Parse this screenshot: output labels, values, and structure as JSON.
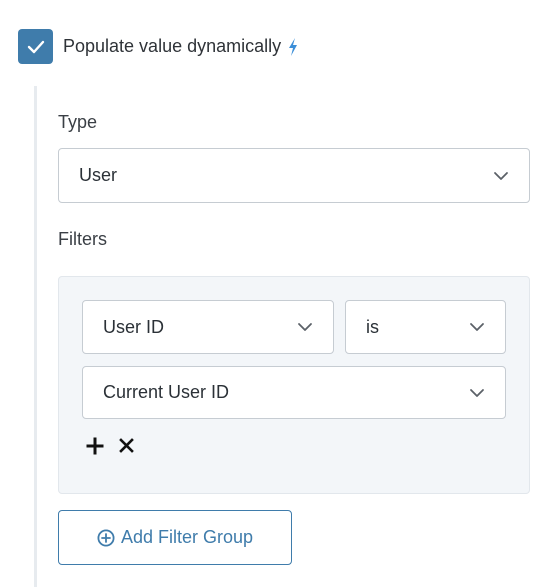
{
  "populate": {
    "label": "Populate value dynamically",
    "checked": true,
    "icon": "lightning-bolt-icon"
  },
  "type_field": {
    "label": "Type",
    "value": "User"
  },
  "filters": {
    "label": "Filters",
    "rows": [
      {
        "field": "User ID",
        "operator": "is",
        "value": "Current User ID"
      }
    ],
    "add_icon": "plus-icon",
    "remove_icon": "close-icon",
    "add_group_label": "Add Filter Group",
    "add_group_icon": "plus-circle-icon"
  },
  "colors": {
    "accent": "#3f7cab",
    "bolt": "#3b8ed8",
    "border": "#c6ccd2",
    "panel": "#f3f6f9"
  }
}
